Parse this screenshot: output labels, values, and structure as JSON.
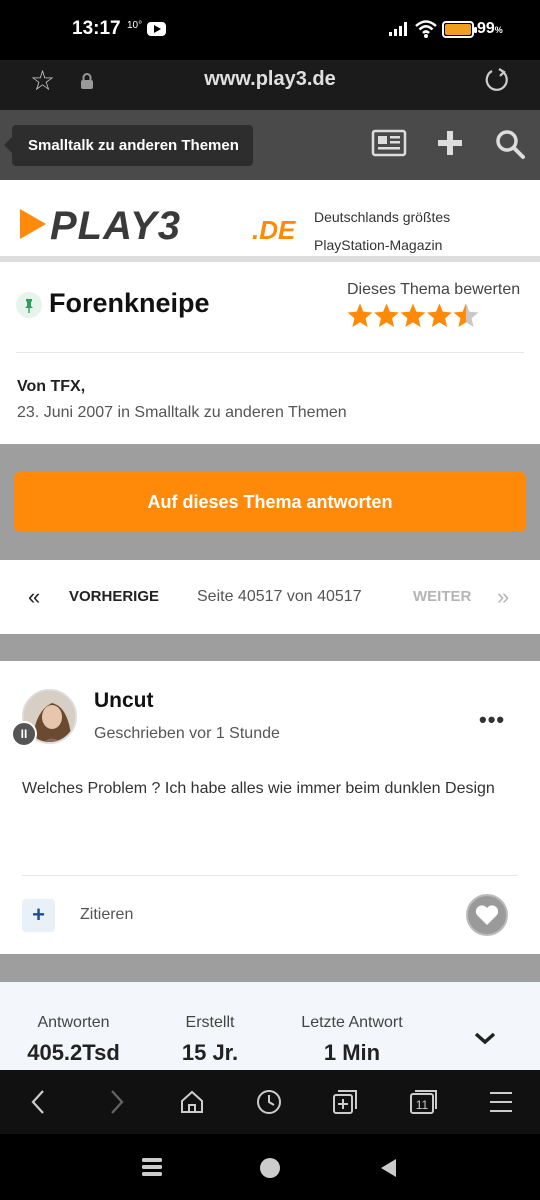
{
  "status_bar": {
    "time": "13:17",
    "temperature": "10°",
    "battery_percent": "99",
    "battery_percent_sign": "%",
    "battery_color": "#f0a020"
  },
  "browser": {
    "url": "www.play3.de"
  },
  "site_header": {
    "breadcrumb": "Smalltalk zu anderen Themen",
    "icons": [
      "news-icon",
      "plus-icon",
      "search-icon"
    ]
  },
  "logo": {
    "text": "PLAY3",
    "suffix": ".DE",
    "accent": "#ff8a0a",
    "tagline_1": "Deutschlands größtes",
    "tagline_2": "PlayStation-Magazin"
  },
  "topic": {
    "title": "Forenkneipe",
    "rate_label": "Dieses Thema bewerten",
    "rating": 4.5,
    "rating_max": 5,
    "by": "Von TFX,",
    "meta": "23. Juni 2007 in Smalltalk zu anderen Themen"
  },
  "reply": {
    "button_label": "Auf dieses Thema antworten",
    "color": "#ff8a0a"
  },
  "pagination": {
    "prev_label": "VORHERIGE",
    "page_info": "Seite 40517 von 40517",
    "next_label": "WEITER"
  },
  "post": {
    "author": "Uncut",
    "posted": "Geschrieben vor 1 Stunde",
    "body": "Welches Problem ? Ich habe alles wie immer beim dunklen Design",
    "quote_label": "Zitieren"
  },
  "stats": {
    "replies_label": "Antworten",
    "replies_value": "405.2Tsd",
    "created_label": "Erstellt",
    "created_value": "15 Jr.",
    "last_label": "Letzte Antwort",
    "last_value": "1 Min"
  },
  "toolbar": {
    "tab_count": "11"
  }
}
